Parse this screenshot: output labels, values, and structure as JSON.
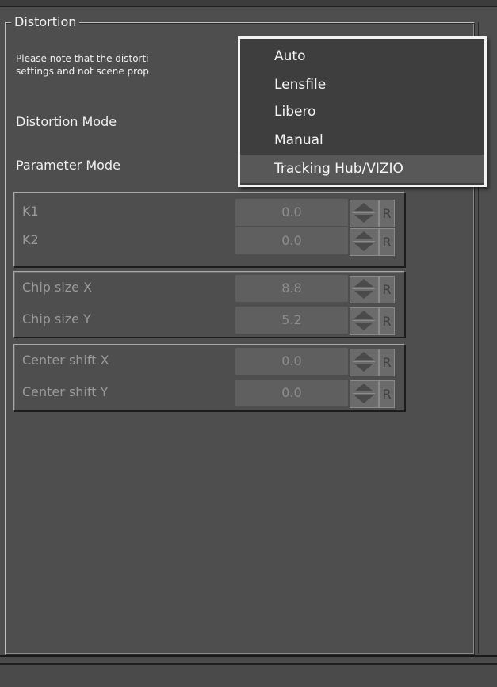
{
  "group": {
    "title": "Distortion"
  },
  "note": {
    "line1": "Please note that the distorti",
    "line2": "settings and not scene prop"
  },
  "labels": {
    "distortion_mode": "Distortion Mode",
    "parameter_mode": "Parameter Mode"
  },
  "panels": [
    {
      "rows": [
        {
          "label": "K1",
          "value": "0.0"
        },
        {
          "label": "K2",
          "value": "0.0"
        }
      ]
    },
    {
      "rows": [
        {
          "label": "Chip size X",
          "value": "8.8"
        },
        {
          "label": "Chip size Y",
          "value": "5.2"
        }
      ]
    },
    {
      "rows": [
        {
          "label": "Center shift X",
          "value": "0.0"
        },
        {
          "label": "Center shift Y",
          "value": "0.0"
        }
      ]
    }
  ],
  "reset_label": "R",
  "dropdown": {
    "options": [
      "Auto",
      "Lensfile",
      "Libero",
      "Manual",
      "Tracking Hub/VIZIO"
    ],
    "highlighted": "Tracking Hub/VIZIO"
  },
  "colors": {
    "background": "#4e4e4e",
    "dropdown_bg": "#3e3e3e",
    "highlight": "#585858",
    "disabled_text": "#9a9a9a"
  }
}
